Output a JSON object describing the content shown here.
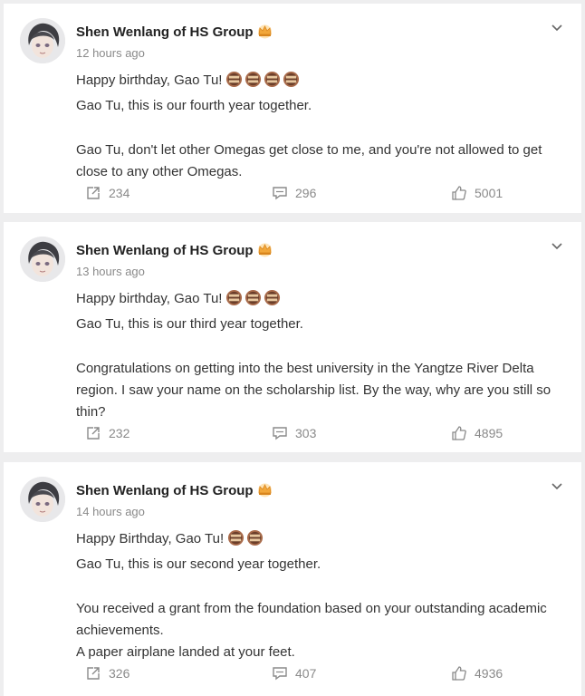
{
  "posts": [
    {
      "author": "Shen Wenlang of HS Group",
      "time": "12 hours ago",
      "greeting": "Happy birthday, Gao Tu!",
      "cake_count": 4,
      "lines": [
        "Gao Tu, this is our fourth year together.",
        "",
        "Gao Tu, don't let other Omegas get close to me, and you're not allowed to get close to any other Omegas."
      ],
      "shares": "234",
      "comments": "296",
      "likes": "5001"
    },
    {
      "author": "Shen Wenlang of HS Group",
      "time": "13 hours ago",
      "greeting": "Happy birthday, Gao Tu!",
      "cake_count": 3,
      "lines": [
        "Gao Tu, this is our third year together.",
        "",
        "Congratulations on getting into the best university in the Yangtze River Delta region. I saw your name on the scholarship list. By the way, why are you still so thin?"
      ],
      "shares": "232",
      "comments": "303",
      "likes": "4895"
    },
    {
      "author": "Shen Wenlang of HS Group",
      "time": "14 hours ago",
      "greeting": "Happy Birthday, Gao Tu!",
      "cake_count": 2,
      "lines": [
        "Gao Tu, this is our second year together.",
        "",
        "You received a grant from the foundation based on your outstanding academic achievements.",
        "A paper airplane landed at your feet."
      ],
      "shares": "326",
      "comments": "407",
      "likes": "4936"
    }
  ],
  "icons": {
    "expand": "chevron-down-icon",
    "share": "share-icon",
    "comment": "comment-icon",
    "like": "thumbs-up-icon",
    "badge": "crown-icon",
    "emoji": "cake-icon"
  },
  "colors": {
    "background": "#eeeeef",
    "card": "#ffffff",
    "text": "#333333",
    "muted": "#8a8a8a",
    "crown": "#f2a73a"
  }
}
